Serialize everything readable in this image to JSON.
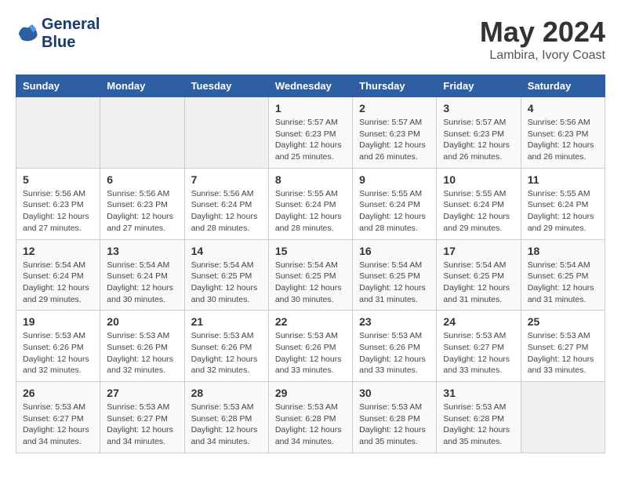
{
  "header": {
    "logo_line1": "General",
    "logo_line2": "Blue",
    "month": "May 2024",
    "location": "Lambira, Ivory Coast"
  },
  "weekdays": [
    "Sunday",
    "Monday",
    "Tuesday",
    "Wednesday",
    "Thursday",
    "Friday",
    "Saturday"
  ],
  "weeks": [
    [
      {
        "day": "",
        "info": ""
      },
      {
        "day": "",
        "info": ""
      },
      {
        "day": "",
        "info": ""
      },
      {
        "day": "1",
        "info": "Sunrise: 5:57 AM\nSunset: 6:23 PM\nDaylight: 12 hours\nand 25 minutes."
      },
      {
        "day": "2",
        "info": "Sunrise: 5:57 AM\nSunset: 6:23 PM\nDaylight: 12 hours\nand 26 minutes."
      },
      {
        "day": "3",
        "info": "Sunrise: 5:57 AM\nSunset: 6:23 PM\nDaylight: 12 hours\nand 26 minutes."
      },
      {
        "day": "4",
        "info": "Sunrise: 5:56 AM\nSunset: 6:23 PM\nDaylight: 12 hours\nand 26 minutes."
      }
    ],
    [
      {
        "day": "5",
        "info": "Sunrise: 5:56 AM\nSunset: 6:23 PM\nDaylight: 12 hours\nand 27 minutes."
      },
      {
        "day": "6",
        "info": "Sunrise: 5:56 AM\nSunset: 6:23 PM\nDaylight: 12 hours\nand 27 minutes."
      },
      {
        "day": "7",
        "info": "Sunrise: 5:56 AM\nSunset: 6:24 PM\nDaylight: 12 hours\nand 28 minutes."
      },
      {
        "day": "8",
        "info": "Sunrise: 5:55 AM\nSunset: 6:24 PM\nDaylight: 12 hours\nand 28 minutes."
      },
      {
        "day": "9",
        "info": "Sunrise: 5:55 AM\nSunset: 6:24 PM\nDaylight: 12 hours\nand 28 minutes."
      },
      {
        "day": "10",
        "info": "Sunrise: 5:55 AM\nSunset: 6:24 PM\nDaylight: 12 hours\nand 29 minutes."
      },
      {
        "day": "11",
        "info": "Sunrise: 5:55 AM\nSunset: 6:24 PM\nDaylight: 12 hours\nand 29 minutes."
      }
    ],
    [
      {
        "day": "12",
        "info": "Sunrise: 5:54 AM\nSunset: 6:24 PM\nDaylight: 12 hours\nand 29 minutes."
      },
      {
        "day": "13",
        "info": "Sunrise: 5:54 AM\nSunset: 6:24 PM\nDaylight: 12 hours\nand 30 minutes."
      },
      {
        "day": "14",
        "info": "Sunrise: 5:54 AM\nSunset: 6:25 PM\nDaylight: 12 hours\nand 30 minutes."
      },
      {
        "day": "15",
        "info": "Sunrise: 5:54 AM\nSunset: 6:25 PM\nDaylight: 12 hours\nand 30 minutes."
      },
      {
        "day": "16",
        "info": "Sunrise: 5:54 AM\nSunset: 6:25 PM\nDaylight: 12 hours\nand 31 minutes."
      },
      {
        "day": "17",
        "info": "Sunrise: 5:54 AM\nSunset: 6:25 PM\nDaylight: 12 hours\nand 31 minutes."
      },
      {
        "day": "18",
        "info": "Sunrise: 5:54 AM\nSunset: 6:25 PM\nDaylight: 12 hours\nand 31 minutes."
      }
    ],
    [
      {
        "day": "19",
        "info": "Sunrise: 5:53 AM\nSunset: 6:26 PM\nDaylight: 12 hours\nand 32 minutes."
      },
      {
        "day": "20",
        "info": "Sunrise: 5:53 AM\nSunset: 6:26 PM\nDaylight: 12 hours\nand 32 minutes."
      },
      {
        "day": "21",
        "info": "Sunrise: 5:53 AM\nSunset: 6:26 PM\nDaylight: 12 hours\nand 32 minutes."
      },
      {
        "day": "22",
        "info": "Sunrise: 5:53 AM\nSunset: 6:26 PM\nDaylight: 12 hours\nand 33 minutes."
      },
      {
        "day": "23",
        "info": "Sunrise: 5:53 AM\nSunset: 6:26 PM\nDaylight: 12 hours\nand 33 minutes."
      },
      {
        "day": "24",
        "info": "Sunrise: 5:53 AM\nSunset: 6:27 PM\nDaylight: 12 hours\nand 33 minutes."
      },
      {
        "day": "25",
        "info": "Sunrise: 5:53 AM\nSunset: 6:27 PM\nDaylight: 12 hours\nand 33 minutes."
      }
    ],
    [
      {
        "day": "26",
        "info": "Sunrise: 5:53 AM\nSunset: 6:27 PM\nDaylight: 12 hours\nand 34 minutes."
      },
      {
        "day": "27",
        "info": "Sunrise: 5:53 AM\nSunset: 6:27 PM\nDaylight: 12 hours\nand 34 minutes."
      },
      {
        "day": "28",
        "info": "Sunrise: 5:53 AM\nSunset: 6:28 PM\nDaylight: 12 hours\nand 34 minutes."
      },
      {
        "day": "29",
        "info": "Sunrise: 5:53 AM\nSunset: 6:28 PM\nDaylight: 12 hours\nand 34 minutes."
      },
      {
        "day": "30",
        "info": "Sunrise: 5:53 AM\nSunset: 6:28 PM\nDaylight: 12 hours\nand 35 minutes."
      },
      {
        "day": "31",
        "info": "Sunrise: 5:53 AM\nSunset: 6:28 PM\nDaylight: 12 hours\nand 35 minutes."
      },
      {
        "day": "",
        "info": ""
      }
    ]
  ]
}
